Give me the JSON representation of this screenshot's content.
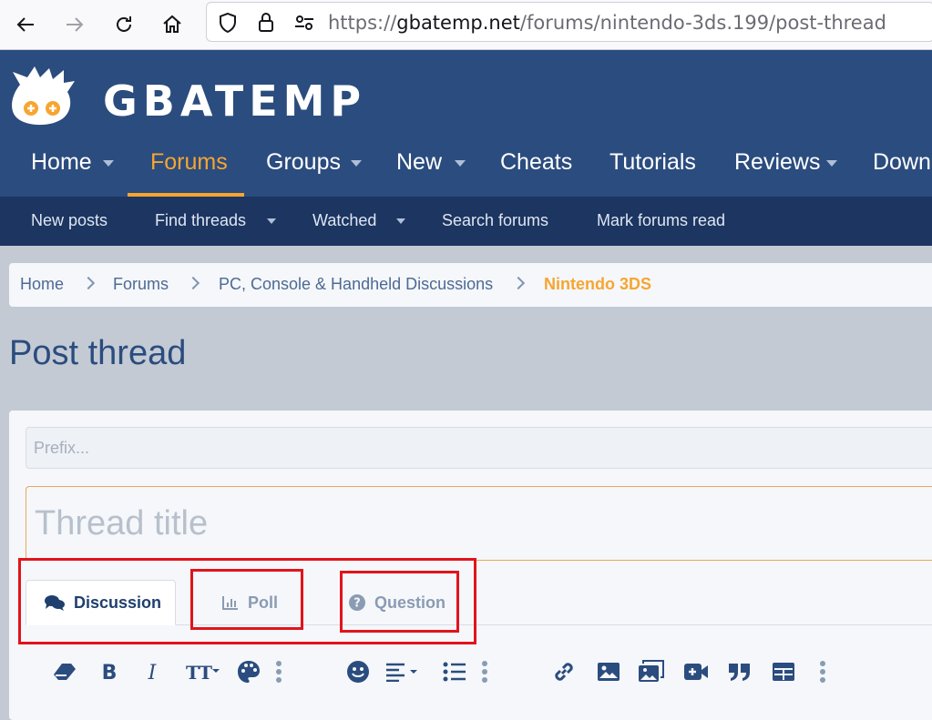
{
  "browser": {
    "url_prefix": "https://",
    "url_domain": "gbatemp.net",
    "url_path": "/forums/nintendo-3ds.199/post-thread"
  },
  "site": {
    "logo_text": "GBATEMP",
    "nav": [
      "Home",
      "Forums",
      "Groups",
      "New",
      "Cheats",
      "Tutorials",
      "Reviews",
      "Downl"
    ],
    "subnav": [
      "New posts",
      "Find threads",
      "Watched",
      "Search forums",
      "Mark forums read"
    ]
  },
  "breadcrumb": [
    "Home",
    "Forums",
    "PC, Console & Handheld Discussions",
    "Nintendo 3DS"
  ],
  "page_title": "Post thread",
  "form": {
    "prefix_placeholder": "Prefix...",
    "title_placeholder": "Thread title",
    "tabs": [
      "Discussion",
      "Poll",
      "Question"
    ]
  },
  "toolbar_icons": [
    "eraser-icon",
    "bold-icon",
    "italic-icon",
    "text-size-icon",
    "palette-icon",
    "more-icon",
    "smilie-icon",
    "align-icon",
    "list-icon",
    "more-icon",
    "link-icon",
    "image-icon",
    "gallery-icon",
    "video-icon",
    "quote-icon",
    "table-icon",
    "more-icon"
  ],
  "colors": {
    "header": "#2b4c7e",
    "subnav": "#1c3561",
    "accent": "#f7a530",
    "highlight": "#e0141c"
  }
}
